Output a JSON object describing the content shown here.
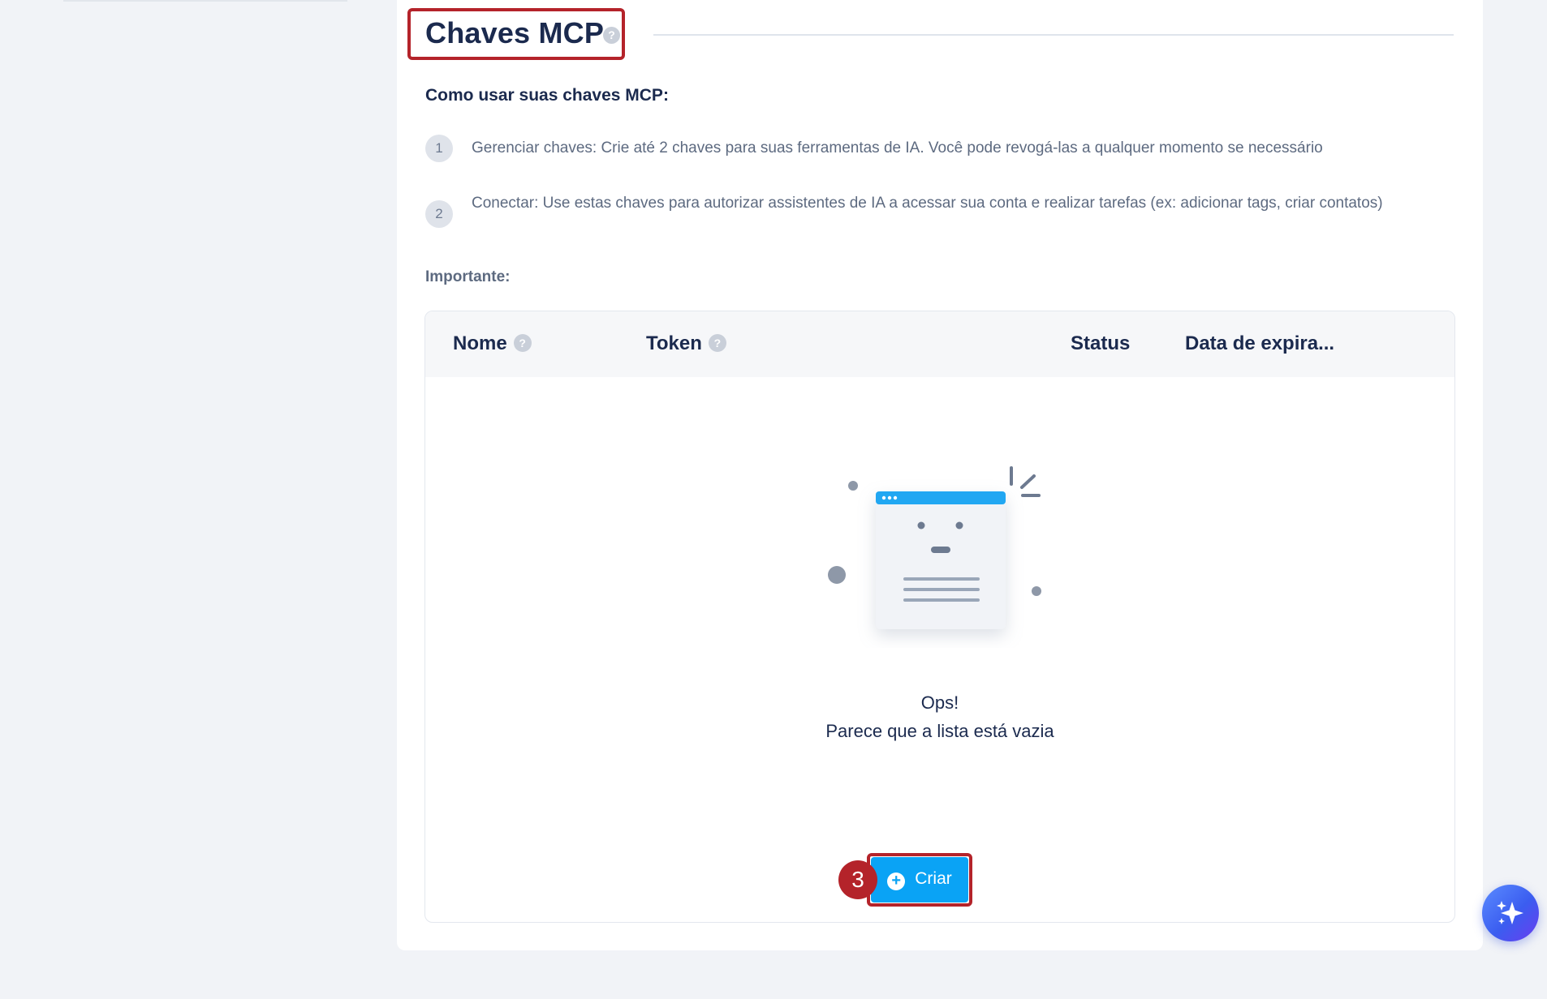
{
  "page": {
    "title": "Chaves MCP",
    "help_glyph": "?"
  },
  "instructions": {
    "heading": "Como usar suas chaves MCP:",
    "steps": [
      {
        "number": "1",
        "text": "Gerenciar chaves: Crie até 2 chaves para suas ferramentas de IA. Você pode revogá-las a qualquer momento se necessário"
      },
      {
        "number": "2",
        "text": "Conectar: Use estas chaves para autorizar assistentes de IA a acessar sua conta e realizar tarefas (ex: adicionar tags, criar contatos)"
      }
    ],
    "important_label": "Importante:"
  },
  "table": {
    "columns": [
      {
        "label": "Nome",
        "has_help": true
      },
      {
        "label": "Token",
        "has_help": true
      },
      {
        "label": "Status",
        "has_help": false
      },
      {
        "label": "Data de expira...",
        "has_help": false
      }
    ],
    "rows": [],
    "empty": {
      "title": "Ops!",
      "message": "Parece que a lista está vazia"
    }
  },
  "actions": {
    "create_label": "Criar",
    "create_icon": "plus-circle-icon",
    "step_marker": "3"
  },
  "fab": {
    "icon": "sparkle-icon"
  },
  "colors": {
    "primary": "#0aa3f5",
    "highlight": "#b4232a",
    "text": "#1b2a4e",
    "muted": "#5d6a80"
  }
}
